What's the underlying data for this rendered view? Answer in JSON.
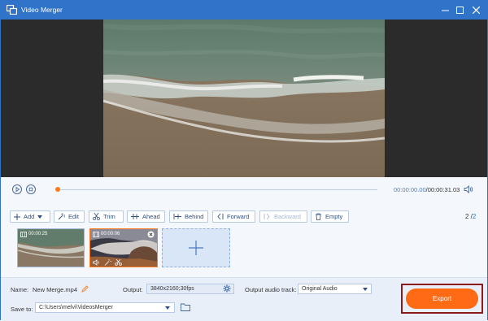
{
  "window": {
    "title": "Video Merger"
  },
  "playback": {
    "current_time": "00:00:00.00",
    "total_time": "/00:00:31.03",
    "progress": 0.0
  },
  "toolbar": {
    "add": "Add",
    "edit": "Edit",
    "trim": "Trim",
    "ahead": "Ahead",
    "behind": "Behind",
    "forward": "Forward",
    "backward": "Backward",
    "empty": "Empty"
  },
  "pagination": {
    "current": "2",
    "sep": " /",
    "total": "2"
  },
  "clips": [
    {
      "time": "00:00:25",
      "selected": false
    },
    {
      "time": "00:00:06",
      "selected": true
    }
  ],
  "output": {
    "name_label": "Name:",
    "name_value": "New Merge.mp4",
    "output_label": "Output:",
    "output_value": "3840x2160;30fps",
    "audio_label": "Output audio track:",
    "audio_value": "Original Audio",
    "save_label": "Save to:",
    "save_value": "C:\\Users\\melvi\\VideosMerger",
    "export": "Export"
  },
  "colors": {
    "accent": "#2f74c9",
    "export": "#ff6a14",
    "progress": "#ff7a1a"
  }
}
